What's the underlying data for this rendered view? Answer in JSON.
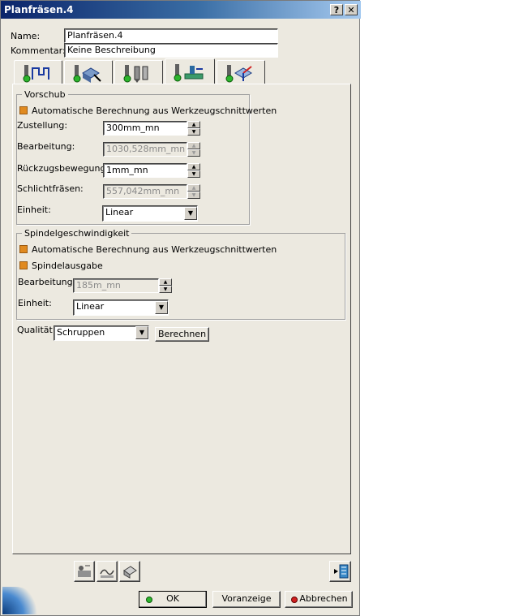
{
  "window": {
    "title": "Planfräsen.4",
    "help_label": "?",
    "close_label": "✕"
  },
  "header": {
    "name_label": "Name:",
    "name_value": "Planfräsen.4",
    "comment_label": "Kommentar:",
    "comment_value": "Keine Beschreibung"
  },
  "tabs": [
    {
      "icon": "strategy-tab-icon"
    },
    {
      "icon": "geometry-tab-icon"
    },
    {
      "icon": "tool-tab-icon"
    },
    {
      "icon": "feeds-speeds-tab-icon",
      "selected": true
    },
    {
      "icon": "macros-tab-icon"
    }
  ],
  "feed": {
    "title": "Vorschub",
    "auto_label": "Automatische Berechnung aus Werkzeugschnittwerten",
    "approach_label": "Zustellung:",
    "approach_value": "300mm_mn",
    "machining_label": "Bearbeitung:",
    "machining_value": "1030,528mm_mn",
    "retract_label": "Rückzugsbewegung:",
    "retract_value": "1mm_mn",
    "finishing_label": "Schlichtfräsen:",
    "finishing_value": "557,042mm_mn",
    "unit_label": "Einheit:",
    "unit_value": "Linear"
  },
  "spindle": {
    "title": "Spindelgeschwindigkeit",
    "auto_label": "Automatische Berechnung aus Werkzeugschnittwerten",
    "output_label": "Spindelausgabe",
    "machining_label": "Bearbeitung:",
    "machining_value": "185m_mn",
    "unit_label": "Einheit:",
    "unit_value": "Linear"
  },
  "quality": {
    "label": "Qualität:",
    "value": "Schruppen",
    "compute_label": "Berechnen"
  },
  "footer": {
    "ok_label": "OK",
    "preview_label": "Voranzeige",
    "cancel_label": "Abbrechen"
  },
  "colors": {
    "accent": "#e08a20",
    "title_bar": "#0a246a",
    "background": "#ece9e0"
  }
}
